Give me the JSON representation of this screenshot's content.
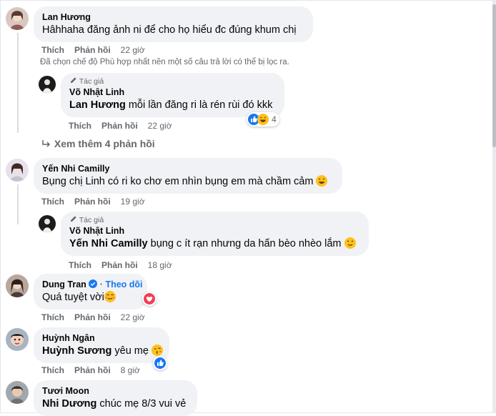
{
  "comments": [
    {
      "name": "Lan Hương",
      "text": "Hâhhaha đăng ảnh ni để cho họ hiểu đc đúng khum chị",
      "like": "Thích",
      "reply": "Phản hồi",
      "time": "22 giờ"
    },
    {
      "name": "Yến Nhi Camilly",
      "text": "Bụng chị Linh có ri ko chơ em nhìn bụng em mà chầm cảm",
      "like": "Thích",
      "reply": "Phản hồi",
      "time": "19 giờ"
    },
    {
      "name": "Dung Tran",
      "follow": "Theo dõi",
      "text": "Quá tuyệt vời",
      "like": "Thích",
      "reply": "Phản hồi",
      "time": "22 giờ"
    },
    {
      "name": "Huỳnh Ngân",
      "mention": "Huỳnh Sương",
      "text": "yêu mẹ",
      "like": "Thích",
      "reply": "Phản hồi",
      "time": "8 giờ"
    },
    {
      "name": "Tươi Moon",
      "mention": "Nhi Dương",
      "text": "chúc mẹ 8/3 vui vẻ"
    }
  ],
  "filter_note": "Đã chọn chế độ Phù hợp nhất nên một số câu trả lời có thể bị lọc ra.",
  "replies": [
    {
      "author_tag": "Tác giả",
      "name": "Võ Nhật Linh",
      "mention": "Lan Hương",
      "text": "mỗi lần đăng ri là rén rùi đó kkk",
      "reaction_count": "4",
      "like": "Thích",
      "reply": "Phản hồi",
      "time": "22 giờ"
    },
    {
      "author_tag": "Tác giả",
      "name": "Võ Nhật Linh",
      "mention": "Yến Nhi Camilly",
      "text": "bụng c ít rạn nhưng da hấn bèo nhèo lắm",
      "like": "Thích",
      "reply": "Phản hồi",
      "time": "18 giờ"
    }
  ],
  "more_replies": "Xem thêm 4 phản hồi",
  "colors": {
    "bubble": "#f0f2f5",
    "link": "#385898",
    "muted": "#65676b",
    "like_blue": "#1877f2",
    "love_red": "#f33e58",
    "haha_yellow": "#fcc21b"
  },
  "icons": [
    "pencil-icon",
    "verified-badge-icon",
    "like-reaction-icon",
    "haha-reaction-icon",
    "love-reaction-icon",
    "smile-emoji-icon",
    "kiss-emoji-icon",
    "in-love-emoji-icon"
  ]
}
